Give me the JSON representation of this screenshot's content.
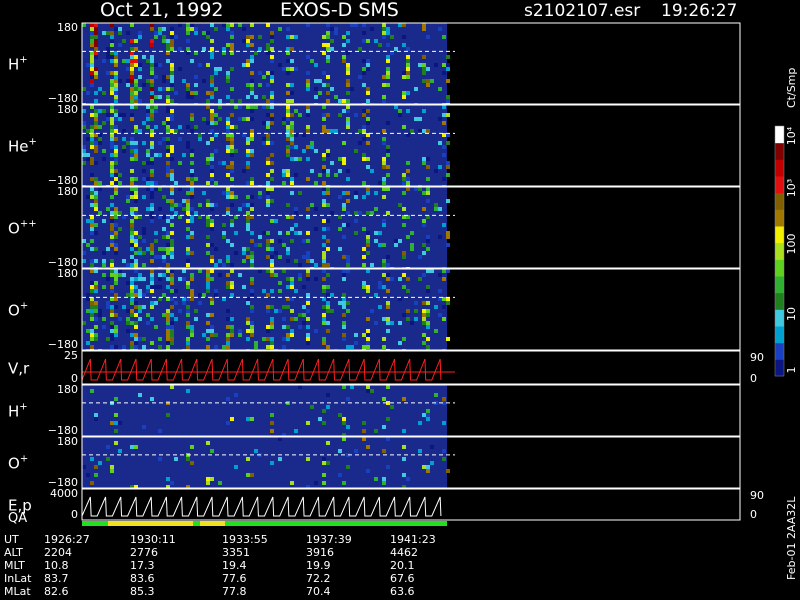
{
  "header": {
    "date": "Oct 21, 1992",
    "instrument": "EXOS-D SMS",
    "file": "s2102107.esr",
    "time": "19:26:27"
  },
  "colors": {
    "background": "#000000",
    "panel_fill": "#1a2a8c",
    "frame": "#ffffff",
    "reference_line": "#ffffff",
    "vr_trace": "#ff2020",
    "qa_good": "#20e020",
    "qa_warn": "#f0e020"
  },
  "chart_data": {
    "type": "heatmap",
    "title": "Oct 21, 1992    EXOS-D SMS",
    "x_axis": {
      "label": "UT",
      "ticks": [
        "1926:27",
        "1930:11",
        "1933:55",
        "1937:39",
        "1941:23"
      ]
    },
    "colorbar": {
      "label": "Ct/Smp",
      "scale": "log",
      "range": [
        1,
        10000
      ],
      "tick_labels": [
        "10⁴",
        "10³",
        "100",
        "10",
        "1"
      ],
      "palette": [
        "#0b1680",
        "#1840c0",
        "#00a0d0",
        "#40c8e0",
        "#208020",
        "#30b030",
        "#60d020",
        "#a8e020",
        "#f0f000",
        "#a07800",
        "#806000",
        "#e01010",
        "#c00000",
        "#800000",
        "#ffffff"
      ]
    },
    "panels": [
      {
        "label": "H",
        "sup": "+",
        "ymax": "180",
        "ymin": "−180",
        "sampled": "dense"
      },
      {
        "label": "He",
        "sup": "+",
        "ymax": "180",
        "ymin": "−180",
        "sampled": "dense"
      },
      {
        "label": "O",
        "sup": "++",
        "ymax": "180",
        "ymin": "−180",
        "sampled": "dense"
      },
      {
        "label": "O",
        "sup": "+",
        "ymax": "180",
        "ymin": "−180",
        "sampled": "dense"
      },
      {
        "label": "V,r",
        "ymax": "25",
        "ymin": "0",
        "right_top": "90",
        "right_bottom": "0",
        "type": "line"
      },
      {
        "label": "H",
        "sup": "+",
        "ymax": "180",
        "ymin": "−180",
        "sampled": "sparse"
      },
      {
        "label": "O",
        "sup": "+",
        "ymax": "180",
        "ymin": "−180",
        "sampled": "sparse"
      },
      {
        "label": "E,p",
        "label2": "QA",
        "ymax": "4000",
        "ymin": "0",
        "right_top": "90",
        "right_bottom": "0",
        "type": "line"
      }
    ],
    "orbit_table": {
      "rows": [
        {
          "name": "UT",
          "values": [
            "1926:27",
            "1930:11",
            "1933:55",
            "1937:39",
            "1941:23"
          ]
        },
        {
          "name": "ALT",
          "values": [
            "2204",
            "2776",
            "3351",
            "3916",
            "4462"
          ]
        },
        {
          "name": "MLT",
          "values": [
            "10.8",
            "17.3",
            "19.4",
            "19.9",
            "20.1"
          ]
        },
        {
          "name": "InLat",
          "values": [
            "83.7",
            "83.6",
            "77.6",
            "72.2",
            "67.6"
          ]
        },
        {
          "name": "MLat",
          "values": [
            "82.6",
            "85.3",
            "77.8",
            "70.4",
            "63.6"
          ]
        }
      ]
    },
    "side_note": "Feb-01 2AA32L"
  }
}
